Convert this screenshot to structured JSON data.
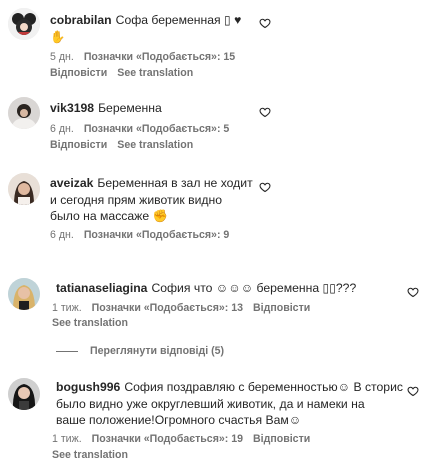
{
  "comments": [
    {
      "username": "cobrabilan",
      "text": "Софа беременная ▯ ♥",
      "text2": "✋",
      "time": "5 дн.",
      "likes": "Позначки «Подобається»: 15",
      "reply": "Відповісти",
      "translate": "See translation"
    },
    {
      "username": "vik3198",
      "text": "Беременна",
      "time": "6 дн.",
      "likes": "Позначки «Подобається»: 5",
      "reply": "Відповісти",
      "translate": "See translation"
    },
    {
      "username": "aveizak",
      "line1": "Беременная в зал не ходит",
      "line2": "и сегодня прям животик видно",
      "line3": "было на массаже ✊",
      "time": "6 дн.",
      "likes": "Позначки «Подобається»: 9"
    },
    {
      "username": "tatianaseliagina",
      "text": "София что ☺☺☺ беременна ▯▯???",
      "time": "1 тиж.",
      "likes": "Позначки «Подобається»: 13",
      "reply": "Відповісти",
      "translate": "See translation"
    },
    {
      "username": "bogush996",
      "line1": "София поздравляю с беременностью☺ В сторис",
      "line2": "было видно уже округлевший животик, да и намеки на",
      "line3": "ваше положение!Огромного счастья Вам☺",
      "time": "1 тиж.",
      "likes": "Позначки «Подобається»: 19",
      "reply": "Відповісти",
      "translate": "See translation"
    }
  ],
  "view_replies": "Переглянути відповіді (5)",
  "icons": {
    "heart": "heart-outline-icon"
  },
  "colors": {
    "text": "#262626",
    "muted": "#737373"
  }
}
